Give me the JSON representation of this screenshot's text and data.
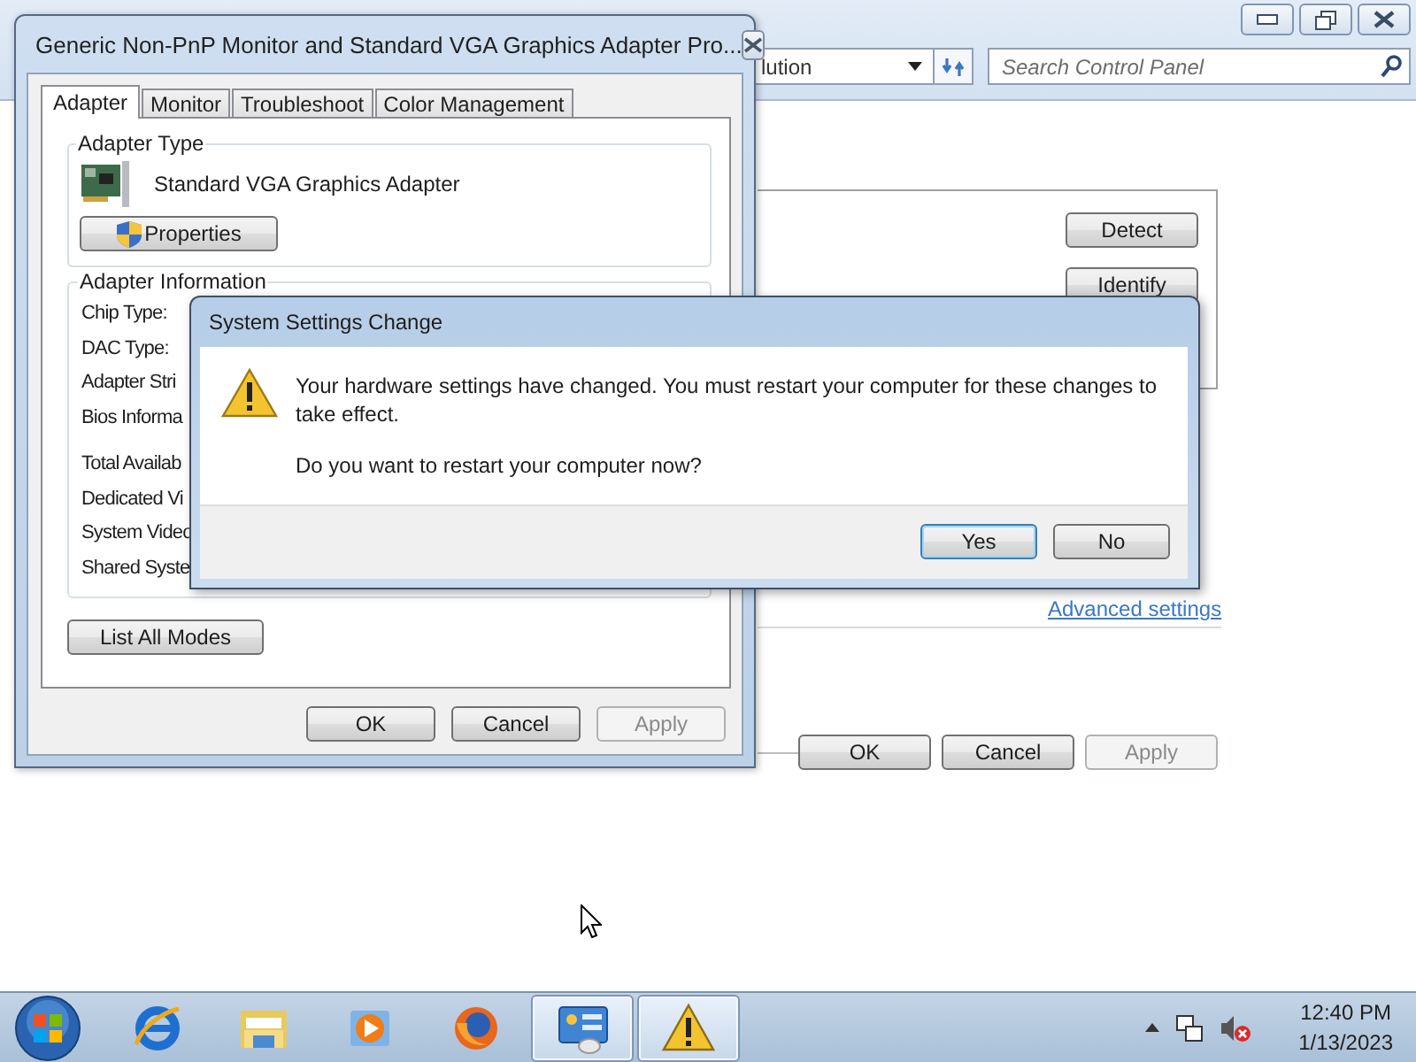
{
  "control_panel": {
    "address_text": "lution",
    "search": {
      "placeholder": "Search Control Panel"
    },
    "buttons": [
      {
        "label": "Detect"
      },
      {
        "label": "Identify"
      }
    ],
    "link": "Advanced settings",
    "footer_buttons": [
      {
        "label": "OK",
        "disabled": false
      },
      {
        "label": "Cancel",
        "disabled": false
      },
      {
        "label": "Apply",
        "disabled": true
      }
    ]
  },
  "properties_dialog": {
    "title": "Generic Non-PnP Monitor and Standard VGA Graphics Adapter Pro...",
    "tabs": [
      {
        "label": "Adapter",
        "selected": true
      },
      {
        "label": "Monitor",
        "selected": false
      },
      {
        "label": "Troubleshoot",
        "selected": false
      },
      {
        "label": "Color Management",
        "selected": false
      }
    ],
    "adapter_type": {
      "heading": "Adapter Type",
      "name": "Standard VGA Graphics Adapter",
      "button": "Properties"
    },
    "adapter_information": {
      "heading": "Adapter Information",
      "labels": [
        "Chip Type:",
        "DAC Type:",
        "Adapter Stri",
        "Bios Informa",
        "Total Availab",
        "Dedicated Vi",
        "System Video",
        "Shared Syste"
      ]
    },
    "list_button": "List All Modes",
    "buttons": [
      {
        "label": "OK",
        "disabled": false
      },
      {
        "label": "Cancel",
        "disabled": false
      },
      {
        "label": "Apply",
        "disabled": true
      }
    ]
  },
  "message_dialog": {
    "title": "System Settings Change",
    "message": "Your hardware settings have changed. You must restart your computer for these changes to take effect.",
    "question": "Do you want to restart your computer now?",
    "buttons": [
      {
        "label": "Yes",
        "default": true
      },
      {
        "label": "No",
        "default": false
      }
    ]
  },
  "taskbar": {
    "apps": [
      {
        "kind": "ie",
        "active": false
      },
      {
        "kind": "explorer",
        "active": false
      },
      {
        "kind": "media",
        "active": false
      },
      {
        "kind": "firefox",
        "active": false
      },
      {
        "kind": "control-panel",
        "active": true
      },
      {
        "kind": "warning",
        "active": true
      }
    ],
    "clock_time": "12:40 PM",
    "clock_date": "1/13/2023"
  }
}
